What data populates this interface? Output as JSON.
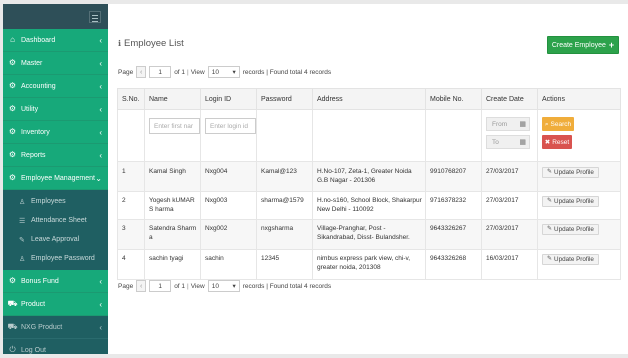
{
  "sidebar": {
    "items": [
      {
        "label": "Dashboard",
        "icon": "home-icon",
        "glyph": "⌂"
      },
      {
        "label": "Master",
        "icon": "gear-icon",
        "glyph": "⚙"
      },
      {
        "label": "Accounting",
        "icon": "gear-icon",
        "glyph": "⚙"
      },
      {
        "label": "Utility",
        "icon": "gear-icon",
        "glyph": "⚙"
      },
      {
        "label": "Inventory",
        "icon": "gear-icon",
        "glyph": "⚙"
      },
      {
        "label": "Reports",
        "icon": "gear-icon",
        "glyph": "⚙"
      },
      {
        "label": "Employee Management",
        "icon": "gear-icon",
        "glyph": "⚙"
      }
    ],
    "submenu": [
      {
        "label": "Employees",
        "icon": "user-icon",
        "glyph": "♙"
      },
      {
        "label": "Attendance Sheet",
        "icon": "list-icon",
        "glyph": "☰"
      },
      {
        "label": "Leave Approval",
        "icon": "edit-icon",
        "glyph": "✎"
      },
      {
        "label": "Employee Password",
        "icon": "user-icon",
        "glyph": "♙"
      }
    ],
    "bottom_items": [
      {
        "label": "Bonus Fund",
        "icon": "gear-icon",
        "glyph": "⚙"
      },
      {
        "label": "Product",
        "icon": "cart-icon",
        "glyph": "🛒"
      }
    ],
    "extra_items": [
      {
        "label": "NXG Product",
        "icon": "cart-icon",
        "glyph": "🛒"
      },
      {
        "label": "Log Out",
        "icon": "logout-icon",
        "glyph": "⏻"
      }
    ]
  },
  "page": {
    "title": "Employee List",
    "create_button": "Create Employee",
    "create_icon": "+"
  },
  "pager": {
    "page_label": "Page",
    "prev": "‹",
    "page_value": "1",
    "of_text": "of 1",
    "view_label": "View",
    "view_value": "10",
    "records_text": "records | Found total 4 records"
  },
  "table": {
    "headers": [
      "S.No.",
      "Name",
      "Login ID",
      "Password",
      "Address",
      "Mobile No.",
      "Create Date",
      "Actions"
    ],
    "filters": {
      "name_placeholder": "Enter first nar",
      "login_placeholder": "Enter login id",
      "from_placeholder": "From",
      "to_placeholder": "To",
      "search_button": "Search",
      "reset_button": "Reset"
    },
    "rows": [
      {
        "sno": "1",
        "name": "Kamal Singh",
        "login": "Nxg004",
        "password": "Kamal@123",
        "address": "H.No-107, Zeta-1, Greater Noida G.B Nagar - 201306",
        "mobile": "9910768207",
        "date": "27/03/2017",
        "action": "Update Profile"
      },
      {
        "sno": "2",
        "name": "Yogesh kUMAR S harma",
        "login": "Nxg003",
        "password": "sharma@1579",
        "address": "H.no-s160, School Block, Shakarpur New Delhi - 110092",
        "mobile": "9716378232",
        "date": "27/03/2017",
        "action": "Update Profile"
      },
      {
        "sno": "3",
        "name": "Satendra Sharm a",
        "login": "Nxg002",
        "password": "nxgsharma",
        "address": "Village-Pranghar, Post - Sikandrabad, Disst- Bulandsher.",
        "mobile": "9643326267",
        "date": "27/03/2017",
        "action": "Update Profile"
      },
      {
        "sno": "4",
        "name": "sachin tyagi",
        "login": "sachin",
        "password": "12345",
        "address": "nimbus express park view, chi-v, greater noida, 201308",
        "mobile": "9643326268",
        "date": "16/03/2017",
        "action": "Update Profile"
      }
    ]
  },
  "colors": {
    "sidebar_green": "#17a97a",
    "sidebar_dark": "#1f5f62",
    "create_button": "#2ca24b",
    "search_button": "#f0ad3b",
    "reset_button": "#d9534f"
  }
}
